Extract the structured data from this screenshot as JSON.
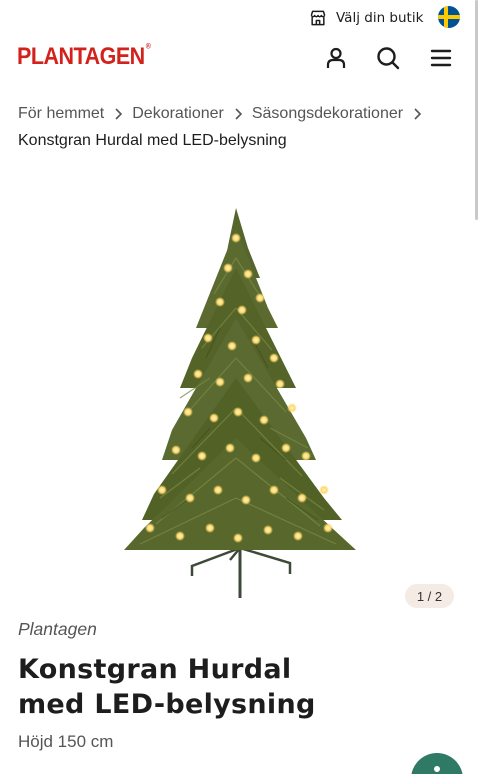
{
  "topbar": {
    "store_label": "Välj din butik",
    "store_icon": "store-icon",
    "flag": "sweden-flag-icon",
    "flag_colors": {
      "blue": "#005293",
      "yellow": "#fecb00"
    }
  },
  "header": {
    "logo_text": "PLANTAGEN",
    "logo_mark": "®",
    "logo_color": "#d3221c",
    "icons": [
      "user-icon",
      "search-icon",
      "menu-icon"
    ]
  },
  "breadcrumb": {
    "items": [
      {
        "label": "För hemmet"
      },
      {
        "label": "Dekorationer"
      },
      {
        "label": "Säsongsdekorationer"
      }
    ],
    "current": "Konstgran Hurdal med LED-belysning"
  },
  "gallery": {
    "counter": "1 / 2",
    "image": "christmas-tree-product-image"
  },
  "product": {
    "brand": "Plantagen",
    "title": "Konstgran Hurdal med LED-belysning",
    "subtitle": "Höjd 150 cm"
  },
  "fab": {
    "icon": "accessibility-icon",
    "color": "#2f7a64"
  }
}
